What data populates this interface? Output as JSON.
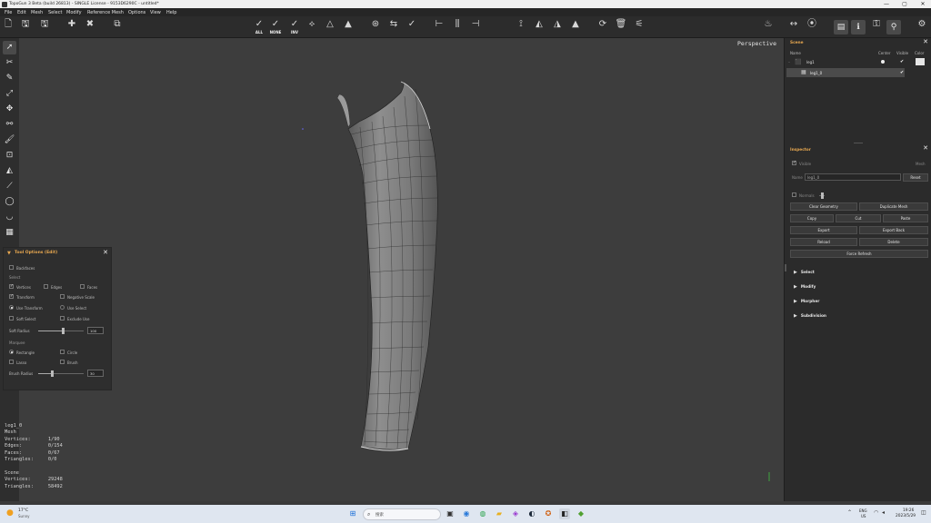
{
  "titlebar": {
    "title": "TopoGun 3 Beta (build 26813) - SINGLE License - 9153D6290C - untitled*",
    "controls": [
      "—",
      "▢",
      "✕"
    ]
  },
  "menu": [
    "File",
    "Edit",
    "Mesh",
    "Select",
    "Modify",
    "Reference Mesh",
    "Options",
    "View",
    "Help"
  ],
  "toolbar": {
    "all_label": "ALL",
    "none_label": "NONE",
    "inv_label": "INV"
  },
  "viewport": {
    "label": "Perspective"
  },
  "tool_options": {
    "title": "Tool Options (Edit)",
    "backfaces": "Backfaces",
    "select_heading": "Select",
    "vertices": "Vertices",
    "edges": "Edges",
    "faces": "Faces",
    "transform": "Transform",
    "negative_scale": "Negative Scale",
    "use_transform": "Use Transform",
    "use_select": "Use Select",
    "soft_select": "Soft Select",
    "exclude_use": "Exclude Use",
    "soft_radius_label": "Soft Radius",
    "soft_radius_value": "100",
    "soft_radius_fraction": 0.55,
    "marquee_heading": "Marquee",
    "rectangle": "Rectangle",
    "circle": "Circle",
    "lasso": "Lasso",
    "brush": "Brush",
    "brush_radius_label": "Brush Radius",
    "brush_radius_value": "30",
    "brush_radius_fraction": 0.3
  },
  "stats": {
    "object_name": "leg1_0",
    "object_type": "Mesh",
    "vertices": "Vertices:      1/90",
    "edges": "Edges:         0/154",
    "faces": "Faces:         0/67",
    "triangles": "Triangles:     0/0",
    "scene_label": "Scene",
    "scene_vertices": "Vertices:      29248",
    "scene_triangles": "Triangles:     58492"
  },
  "scene_panel": {
    "title": "Scene",
    "columns": {
      "name": "Name",
      "center": "Center",
      "visible": "Visible",
      "color": "Color"
    },
    "rows": [
      {
        "name": "leg1",
        "visible": "✔"
      },
      {
        "name": "leg1_0",
        "visible": "✔"
      }
    ]
  },
  "inspector": {
    "title": "Inspector",
    "visible_label": "Visible",
    "type_label": "Mesh",
    "name_label": "Name",
    "name_value": "leg1_0",
    "reset_label": "Reset",
    "normals_label": "Normals",
    "buttons": {
      "clear_geometry": "Clear Geometry",
      "duplicate_mesh": "Duplicate Mesh",
      "copy": "Copy",
      "cut": "Cut",
      "paste": "Paste",
      "export": "Export",
      "export_back": "Export Back",
      "reload": "Reload",
      "delete": "Delete",
      "force_refresh": "Force Refresh"
    },
    "sections": [
      "Select",
      "Modify",
      "Morpher",
      "Subdivision"
    ]
  },
  "taskbar": {
    "weather_temp": "17°C",
    "weather_desc": "Sunny",
    "search_placeholder": "搜索",
    "lang_top": "ENG",
    "lang_bottom": "US",
    "time": "19:26",
    "date": "2023/5/29"
  },
  "colors": {
    "accent": "#e8a850",
    "viewport_bg": "#3d3d3d",
    "panel_bg": "#2b2b2b"
  }
}
